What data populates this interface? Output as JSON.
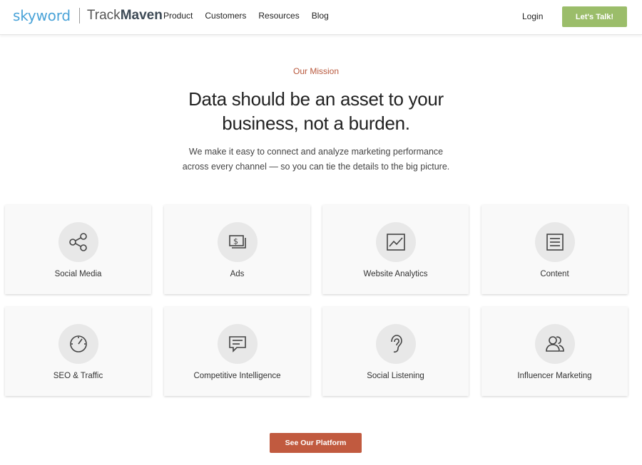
{
  "header": {
    "logo_skyword": "skyword",
    "logo_track": "Track",
    "logo_maven": "Maven",
    "nav": [
      "Product",
      "Customers",
      "Resources",
      "Blog"
    ],
    "login": "Login",
    "cta": "Let's Talk!"
  },
  "hero": {
    "eyebrow": "Our Mission",
    "headline_line1": "Data should be an asset to your",
    "headline_line2": "business, not a burden.",
    "sub_line1": "We make it easy to connect and analyze marketing performance",
    "sub_line2": "across every channel — so you can tie the details to the big picture."
  },
  "cards": [
    {
      "label": "Social Media",
      "icon": "share-icon"
    },
    {
      "label": "Ads",
      "icon": "dollar-bill-icon"
    },
    {
      "label": "Website Analytics",
      "icon": "line-chart-icon"
    },
    {
      "label": "Content",
      "icon": "document-icon"
    },
    {
      "label": "SEO & Traffic",
      "icon": "speedometer-icon"
    },
    {
      "label": "Competitive Intelligence",
      "icon": "chat-bubble-icon"
    },
    {
      "label": "Social Listening",
      "icon": "ear-icon"
    },
    {
      "label": "Influencer Marketing",
      "icon": "people-icon"
    }
  ],
  "platform_button": "See Our Platform",
  "colors": {
    "accent_green": "#9bbd6a",
    "accent_red": "#c15a3f",
    "eyebrow": "#b8583c",
    "skyword_blue": "#4aa3d8"
  }
}
